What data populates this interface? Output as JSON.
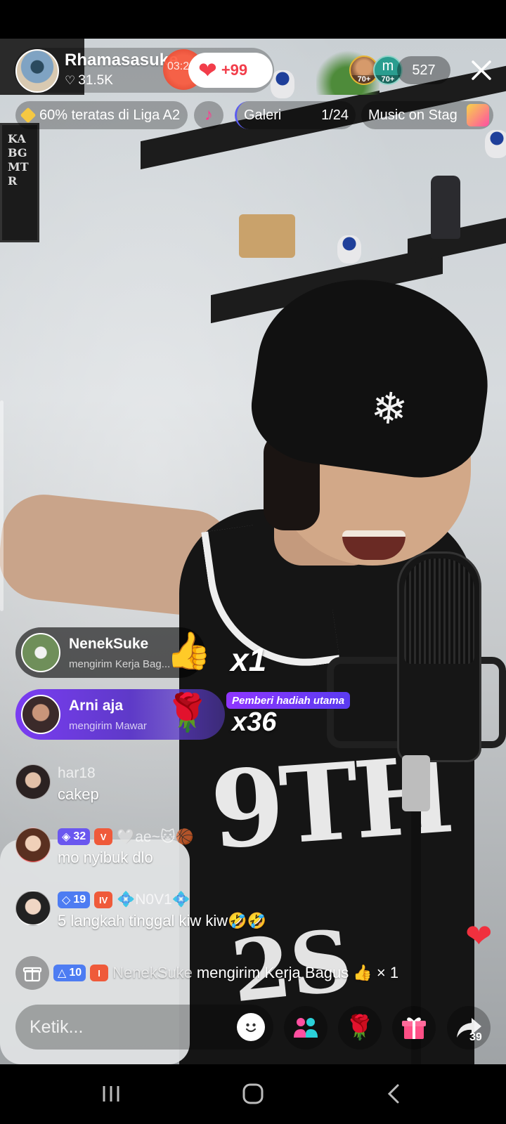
{
  "host": {
    "name": "Rhamasasuke",
    "likes": "31.5K",
    "timer": "03:21",
    "like_badge": "+99"
  },
  "viewers": {
    "avatar1_tag": "70+",
    "avatar2_letter": "m",
    "avatar2_tag": "70+",
    "count": "527"
  },
  "info_bar": {
    "league": "60% teratas di Liga A2",
    "gallery_label": "Galeri",
    "gallery_page": "1/24",
    "stage_label": "Music on Stag"
  },
  "gift_banners": [
    {
      "user": "NenekSuke",
      "text": "mengirim Kerja Bag...",
      "emoji": "👍",
      "combo": "x1"
    },
    {
      "user": "Arni aja",
      "text": "mengirim Mawar",
      "emoji": "🌹",
      "badge": "Pemberi hadiah utama",
      "combo": "x36"
    }
  ],
  "chat": [
    {
      "name": "har18",
      "message": "cakep"
    },
    {
      "level": "32",
      "name": "🤍ae~🐱🏀",
      "message": "mo nyibuk dlo"
    },
    {
      "level": "19",
      "name": "💠N0V1💠",
      "message": "5 langkah tinggal kiw kiw🤣🤣"
    }
  ],
  "gift_notice": {
    "level": "10",
    "user": "NenekSuke",
    "text": "mengirim Kerja Bagus 👍 × 1"
  },
  "input": {
    "placeholder": "Ketik..."
  },
  "share": {
    "count": "39"
  },
  "colors": {
    "accent_red": "#f23d4a",
    "level_purple": "#6a57ef",
    "level_blue": "#4d7cf2",
    "gift_purple": "#7a3cf2"
  }
}
